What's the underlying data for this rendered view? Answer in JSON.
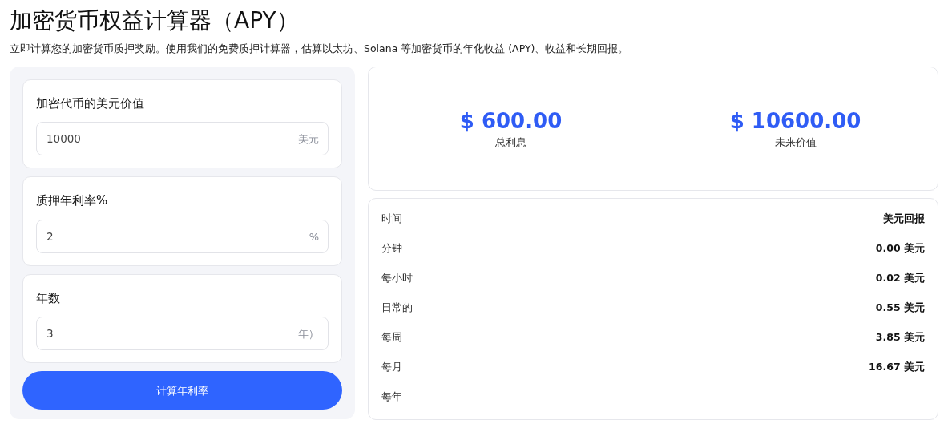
{
  "title": "加密货币权益计算器（APY）",
  "subtitle": "立即计算您的加密货币质押奖励。使用我们的免费质押计算器，估算以太坊、Solana 等加密货币的年化收益 (APY)、收益和长期回报。",
  "inputs": [
    {
      "label": "加密代币的美元价值",
      "value": "10000",
      "unit": "美元"
    },
    {
      "label": "质押年利率%",
      "value": "2",
      "unit": "%"
    },
    {
      "label": "年数",
      "value": "3",
      "unit": "年）"
    }
  ],
  "button": "计算年利率",
  "results": [
    {
      "amount": "$ 600.00",
      "caption": "总利息"
    },
    {
      "amount": "$ 10600.00",
      "caption": "未来价值"
    }
  ],
  "table": {
    "columns": [
      "时间",
      "美元回报"
    ],
    "rows": [
      {
        "period": "分钟",
        "value": "0.00 美元"
      },
      {
        "period": "每小时",
        "value": "0.02 美元"
      },
      {
        "period": "日常的",
        "value": "0.55 美元"
      },
      {
        "period": "每周",
        "value": "3.85 美元"
      },
      {
        "period": "每月",
        "value": "16.67 美元"
      },
      {
        "period": "每年"
      }
    ]
  }
}
